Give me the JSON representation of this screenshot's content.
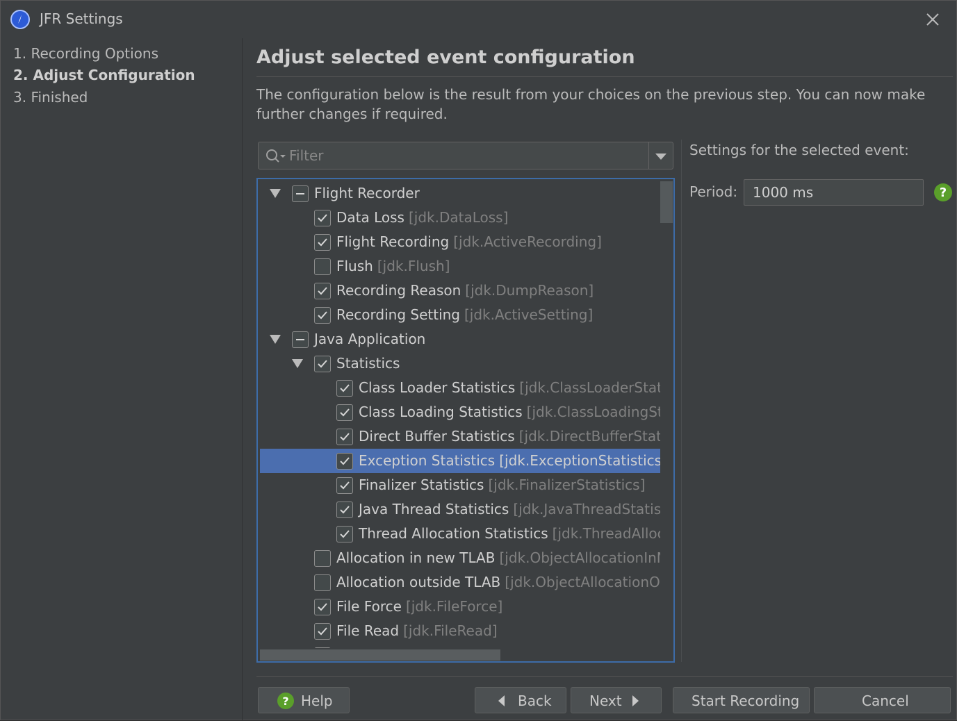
{
  "window": {
    "title": "JFR Settings",
    "icon": "jfr-app-icon",
    "close_icon": "close-icon"
  },
  "steps": [
    {
      "label": "1. Recording Options",
      "active": false
    },
    {
      "label": "2. Adjust Configuration",
      "active": true
    },
    {
      "label": "3. Finished",
      "active": false
    }
  ],
  "main": {
    "heading": "Adjust selected event configuration",
    "description": "The configuration below is the result from your choices on the previous step. You can now make further changes if required.",
    "filter": {
      "placeholder": "Filter",
      "value": ""
    }
  },
  "tree": {
    "rows": [
      {
        "label": "Flight Recorder",
        "id": "",
        "state": "partial",
        "expanded": true,
        "level": 0
      },
      {
        "label": "Data Loss",
        "id": "[jdk.DataLoss]",
        "state": "checked",
        "level": 1
      },
      {
        "label": "Flight Recording",
        "id": "[jdk.ActiveRecording]",
        "state": "checked",
        "level": 1
      },
      {
        "label": "Flush",
        "id": "[jdk.Flush]",
        "state": "unchecked",
        "level": 1
      },
      {
        "label": "Recording Reason",
        "id": "[jdk.DumpReason]",
        "state": "checked",
        "level": 1
      },
      {
        "label": "Recording Setting",
        "id": "[jdk.ActiveSetting]",
        "state": "checked",
        "level": 1
      },
      {
        "label": "Java Application",
        "id": "",
        "state": "partial",
        "expanded": true,
        "level": 0
      },
      {
        "label": "Statistics",
        "id": "",
        "state": "checked",
        "expanded": true,
        "level": 1
      },
      {
        "label": "Class Loader Statistics",
        "id": "[jdk.ClassLoaderStatistics",
        "state": "checked",
        "level": 2
      },
      {
        "label": "Class Loading Statistics",
        "id": "[jdk.ClassLoadingStatist",
        "state": "checked",
        "level": 2
      },
      {
        "label": "Direct Buffer Statistics",
        "id": "[jdk.DirectBufferStatistics",
        "state": "checked",
        "level": 2
      },
      {
        "label": "Exception Statistics",
        "id": "[jdk.ExceptionStatistics]",
        "state": "checked",
        "level": 2,
        "selected": true
      },
      {
        "label": "Finalizer Statistics",
        "id": "[jdk.FinalizerStatistics]",
        "state": "checked",
        "level": 2
      },
      {
        "label": "Java Thread Statistics",
        "id": "[jdk.JavaThreadStatistics]",
        "state": "checked",
        "level": 2
      },
      {
        "label": "Thread Allocation Statistics",
        "id": "[jdk.ThreadAllocatic",
        "state": "checked",
        "level": 2
      },
      {
        "label": "Allocation in new TLAB",
        "id": "[jdk.ObjectAllocationInNew",
        "state": "unchecked",
        "level": 1
      },
      {
        "label": "Allocation outside TLAB",
        "id": "[jdk.ObjectAllocationOutsi",
        "state": "unchecked",
        "level": 1
      },
      {
        "label": "File Force",
        "id": "[jdk.FileForce]",
        "state": "checked",
        "level": 1
      },
      {
        "label": "File Read",
        "id": "[jdk.FileRead]",
        "state": "checked",
        "level": 1
      }
    ]
  },
  "settings": {
    "title": "Settings for the selected event:",
    "period_label": "Period:",
    "period_value": "1000 ms",
    "help_icon": "help-icon"
  },
  "buttons": {
    "help": "Help",
    "back": "Back",
    "next": "Next",
    "start": "Start Recording",
    "cancel": "Cancel"
  },
  "colors": {
    "selection": "#4b6eaf",
    "help_green": "#5a9f2a",
    "tree_border": "#3d6ca8"
  }
}
